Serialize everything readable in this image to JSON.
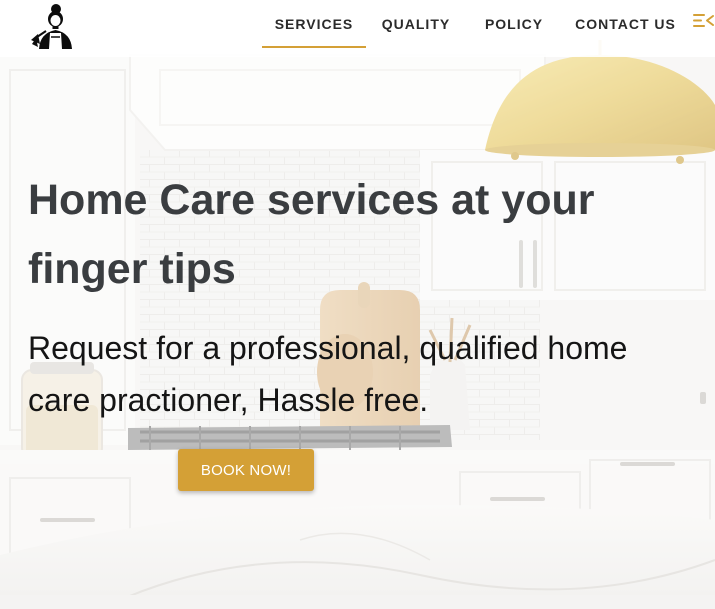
{
  "nav": {
    "items": [
      {
        "label": "SERVICES",
        "active": true
      },
      {
        "label": "QUALITY",
        "active": false
      },
      {
        "label": "POLICY",
        "active": false
      },
      {
        "label": "CONTACT US",
        "active": false
      }
    ]
  },
  "hero": {
    "title": "Home Care services at your finger tips",
    "subtitle": "Request for a professional, qualified home care practioner, Hassle free.",
    "cta_label": "BOOK NOW!"
  },
  "icons": {
    "logo": "cleaning-lady-logo-icon",
    "menu": "menu-toggle-icon"
  },
  "colors": {
    "accent": "#d4a036",
    "title_text": "#3a3d40",
    "body_text": "#151515",
    "button_text": "#ffffff"
  }
}
